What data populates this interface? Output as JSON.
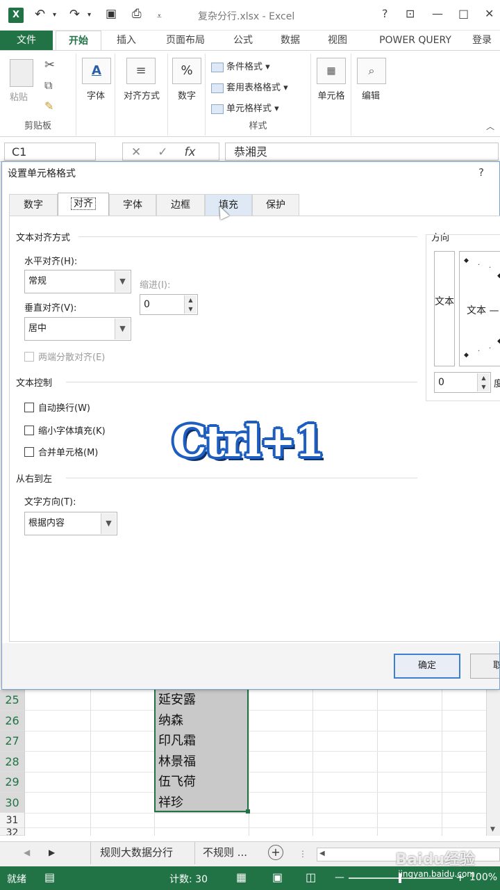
{
  "window": {
    "title": "复杂分行.xlsx - Excel",
    "help": "?",
    "icon": "excel-logo",
    "controls": [
      "help-icon",
      "restore-ribbon-icon",
      "minimize-icon",
      "maximize-icon",
      "close-icon"
    ]
  },
  "ribbon": {
    "file_tab": "文件",
    "tabs": [
      "开始",
      "插入",
      "页面布局",
      "公式",
      "数据",
      "视图",
      "POWER QUERY",
      "登录"
    ],
    "active_tab": "开始",
    "clipboard": {
      "paste": "粘贴",
      "group": "剪贴板"
    },
    "font": {
      "label": "字体"
    },
    "alignment": {
      "label": "对齐方式"
    },
    "number": {
      "label": "数字"
    },
    "styles": {
      "conditional": "条件格式",
      "table": "套用表格格式",
      "cell": "单元格样式",
      "group": "样式"
    },
    "cells": {
      "label": "单元格"
    },
    "editing": {
      "label": "编辑"
    }
  },
  "formula_bar": {
    "name_box": "C1",
    "fx": "fx",
    "content": "恭湘灵"
  },
  "dialog": {
    "title": "设置单元格格式",
    "help": "?",
    "tabs": [
      "数字",
      "对齐",
      "字体",
      "边框",
      "填充",
      "保护"
    ],
    "selected_tab": "对齐",
    "text_alignment": {
      "section": "文本对齐方式",
      "horizontal_label": "水平对齐(H):",
      "horizontal_value": "常规",
      "indent_label": "缩进(I):",
      "indent_value": "0",
      "vertical_label": "垂直对齐(V):",
      "vertical_value": "居中",
      "distributed": "两端分散对齐(E)"
    },
    "text_control": {
      "section": "文本控制",
      "wrap": "自动换行(W)",
      "shrink": "缩小字体填充(K)",
      "merge": "合并单元格(M)"
    },
    "rtl": {
      "section": "从右到左",
      "direction_label": "文字方向(T):",
      "direction_value": "根据内容"
    },
    "orientation": {
      "section": "方向",
      "vertical_text": "文本",
      "dial_text": "文本",
      "degrees_value": "0",
      "degrees_unit": "度"
    },
    "ok": "确定",
    "cancel": "取消"
  },
  "overlay": {
    "text": "Ctrl+1",
    "color": "#1e5ec0"
  },
  "grid": {
    "rows": [
      "25",
      "26",
      "27",
      "28",
      "29",
      "30",
      "31",
      "32"
    ],
    "names": [
      "延安露",
      "纳森",
      "印凡霜",
      "林景福",
      "伍飞荷",
      "祥珍"
    ]
  },
  "sheets": {
    "tabs": [
      "规则大数据分行",
      "不规则 ..."
    ],
    "add": "+"
  },
  "status": {
    "ready": "就绪",
    "count": "计数: 30",
    "zoom": "100%"
  },
  "watermark": {
    "brand": "Baidu经验",
    "url": "jingyan.baidu.com"
  },
  "colors": {
    "accent": "#217346",
    "dialog_border": "#7aa0cf",
    "ok_border": "#3c7fd1"
  }
}
